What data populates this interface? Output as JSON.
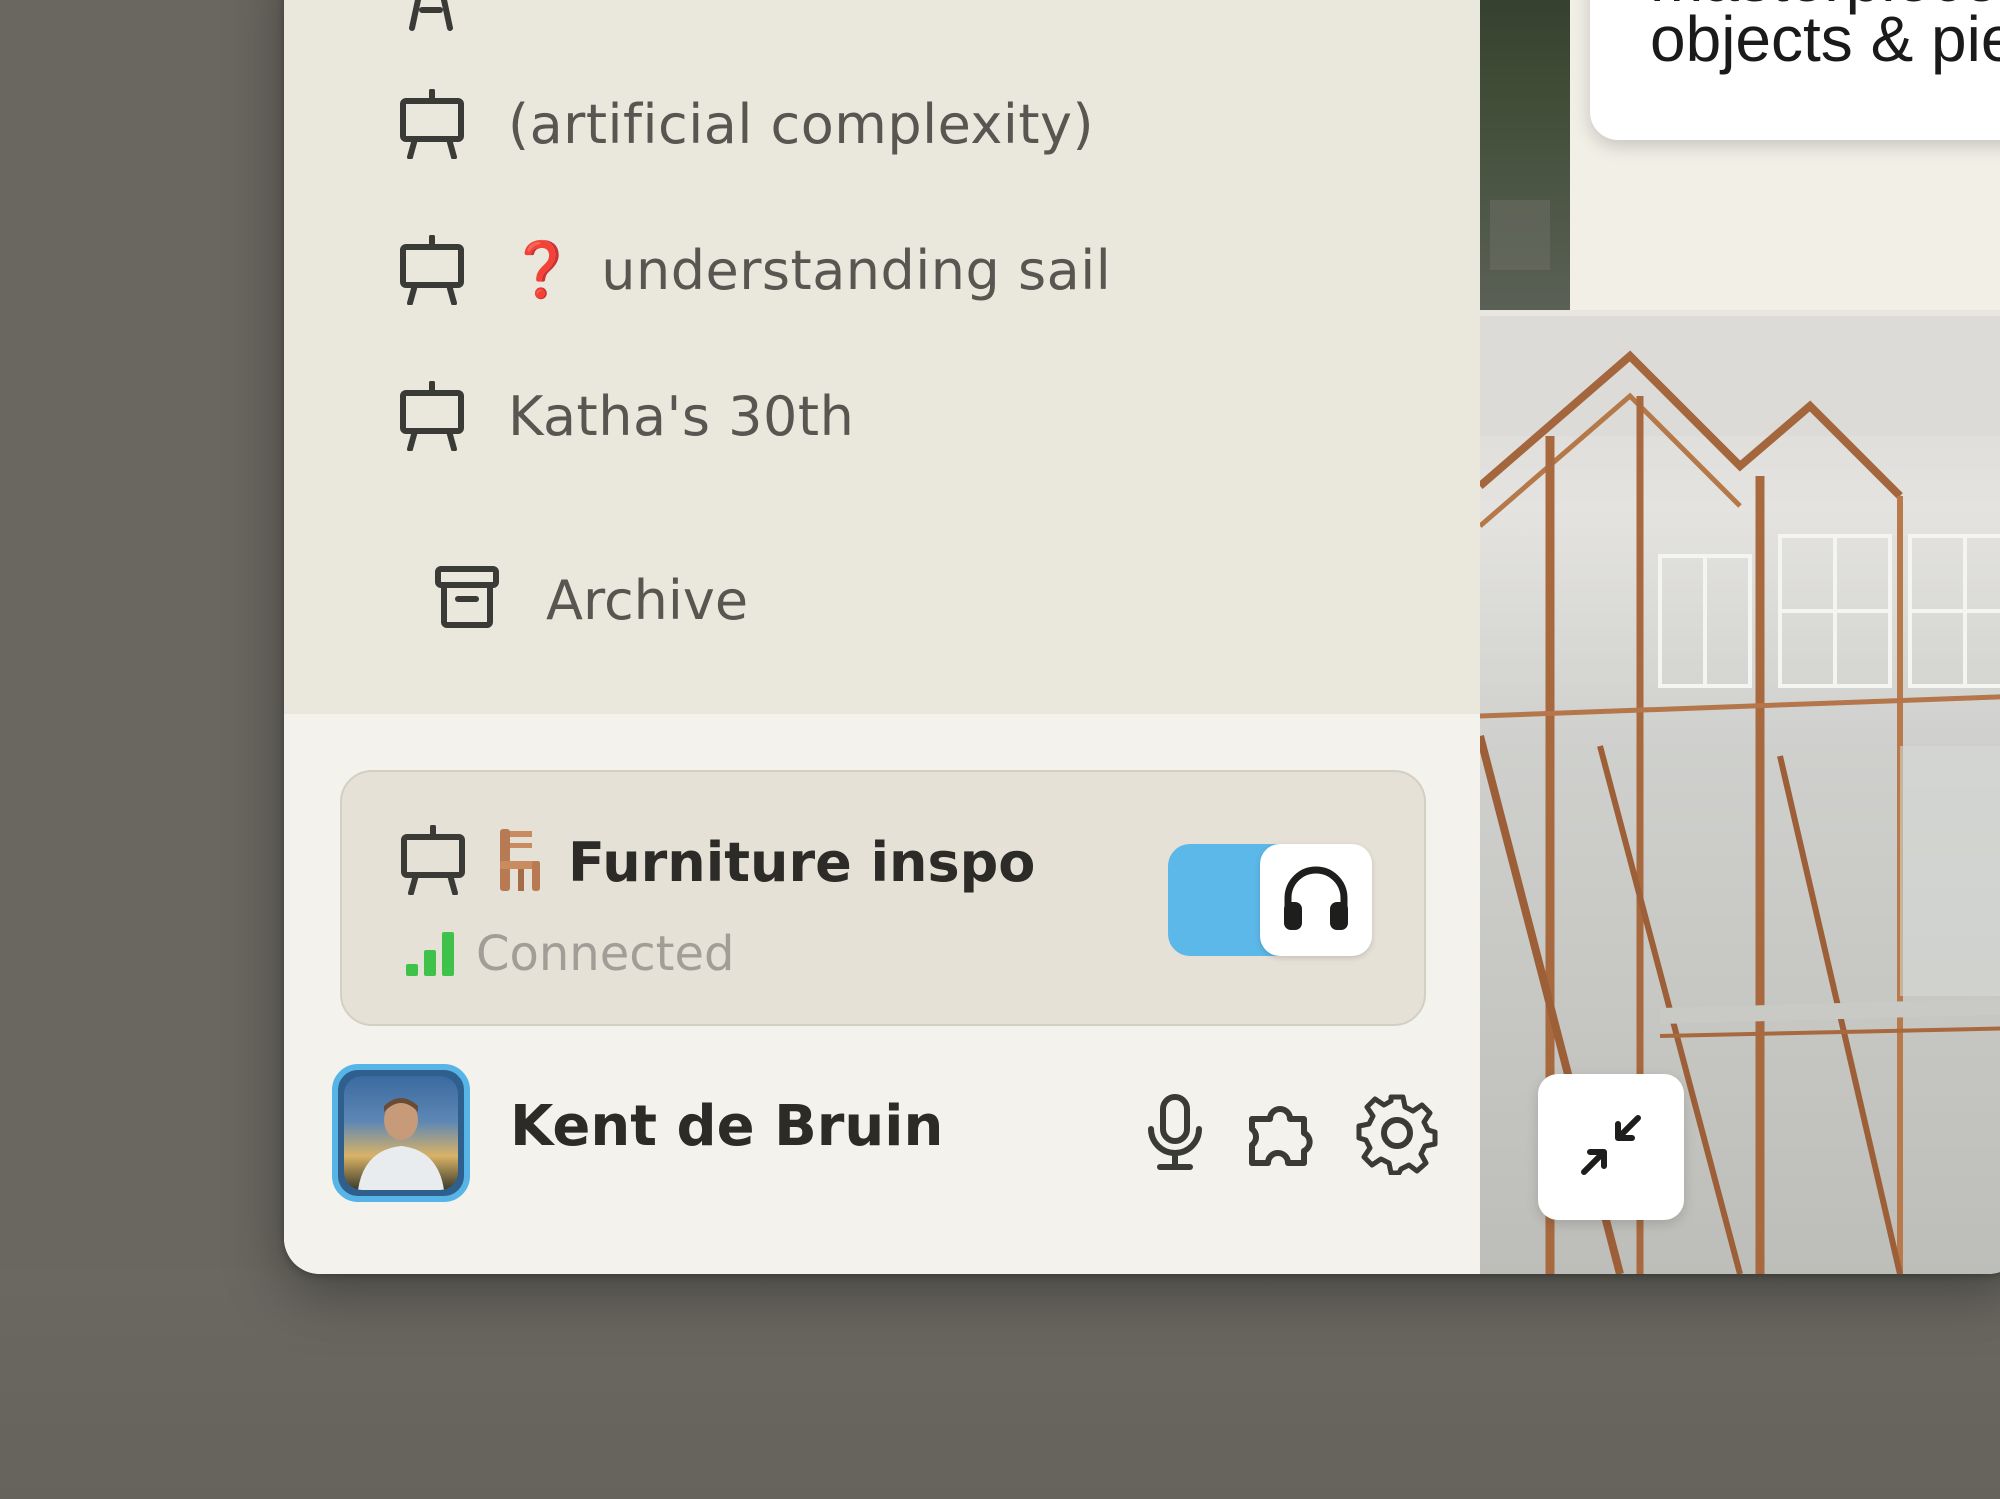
{
  "sidebar": {
    "boards": [
      {
        "label": "(artificial complexity)",
        "icon": "easel-icon"
      },
      {
        "label": "understanding sail",
        "emoji": "❓",
        "icon": "easel-icon"
      },
      {
        "label": "Katha's 30th",
        "icon": "easel-icon"
      }
    ],
    "archive": {
      "label": "Archive",
      "icon": "archive-icon"
    }
  },
  "active_board": {
    "title": "Furniture inspo",
    "emoji_icon": "chair-icon",
    "status": "Connected",
    "toggle_on": true,
    "toggle_icon": "headphones-icon"
  },
  "user": {
    "name": "Kent de Bruin",
    "actions": [
      "microphone-icon",
      "puzzle-icon",
      "gear-icon"
    ]
  },
  "canvas": {
    "card_line1": "masterpieces,",
    "card_line2": "objects & piec",
    "shrink_icon": "minimize-icon"
  },
  "colors": {
    "accent": "#5cb8e8",
    "signal_green": "#3ec24a",
    "sidebar_bg": "#eae7dd",
    "question_red": "#d32f2f"
  }
}
